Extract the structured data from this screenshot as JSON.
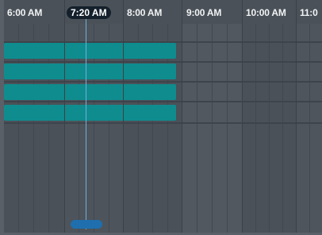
{
  "timeline": {
    "hours": [
      "6:00 AM",
      "8:00 AM",
      "9:00 AM",
      "10:00 AM",
      "11:0"
    ],
    "current_time": "7:20 AM",
    "events": [
      {
        "label": ""
      },
      {
        "label": ""
      },
      {
        "label": ""
      },
      {
        "label": ""
      }
    ]
  },
  "colors": {
    "event": "#0f8c8e",
    "now_line": "#6fb0dd",
    "current_time_pill": "#14202b",
    "scroll_thumb": "#1f6fae"
  }
}
